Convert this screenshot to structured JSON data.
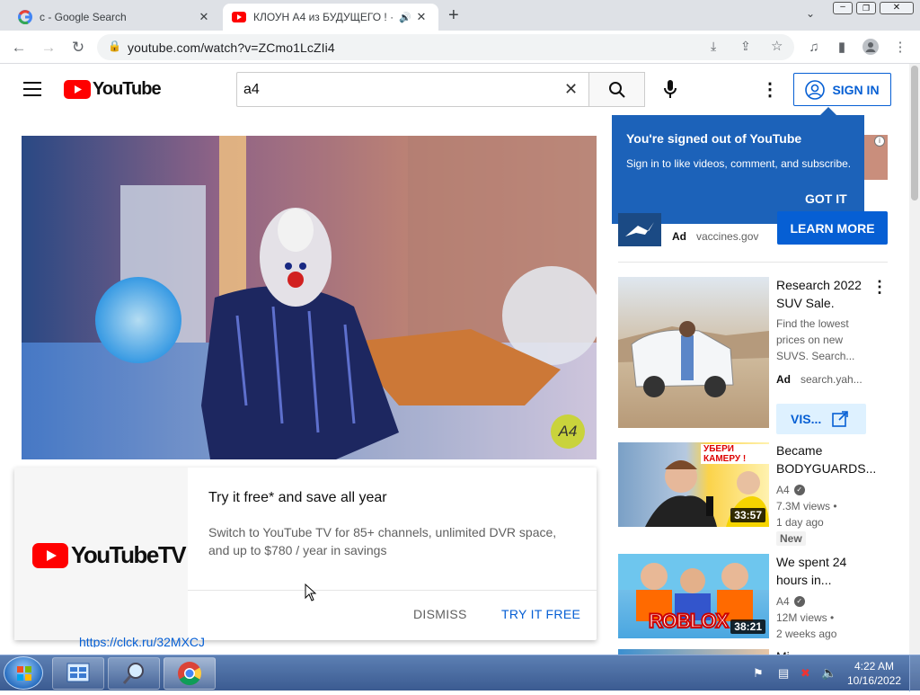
{
  "browser": {
    "tabs": [
      {
        "title": "c - Google Search",
        "favicon": "google-icon"
      },
      {
        "title": "КЛОУН А4 из БУДУЩЕГО ! ·",
        "favicon": "youtube-icon",
        "audio": true
      }
    ],
    "url": "youtube.com/watch?v=ZCmo1LcZIi4"
  },
  "youtube": {
    "logo_text": "YouTube",
    "search_value": "a4",
    "sign_in_label": "SIGN IN",
    "video_watermark": "A4"
  },
  "tooltip": {
    "title": "You're signed out of YouTube",
    "body": "Sign in to like videos, comment, and subscribe.",
    "got_it": "GOT IT"
  },
  "ad_banner": {
    "ad_label": "Ad",
    "source": "vaccines.gov",
    "cta": "LEARN MORE"
  },
  "ytv_promo": {
    "logo_text": "YouTubeTV",
    "headline": "Try it free* and save all year",
    "body": "Switch to YouTube TV for 85+ channels, unlimited DVR space, and up to $780 / year in savings",
    "dismiss": "DISMISS",
    "try_free": "TRY IT FREE",
    "below_link": "https://clck.ru/32MXCJ"
  },
  "sidebar": {
    "ad_video": {
      "title_line1": "Research 2022",
      "title_line2": "SUV Sale.",
      "desc_lines": [
        "Find the lowest",
        "prices on new",
        "SUVS. Search..."
      ],
      "ad_label": "Ad",
      "source": "search.yah...",
      "visit": "VIS..."
    },
    "videos": [
      {
        "title_line1": "Became",
        "title_line2": "BODYGUARDS...",
        "channel": "A4",
        "views": "7.3M views •",
        "age": "1 day ago",
        "badge": "New",
        "duration": "33:57",
        "thumb_text": "УБЕРИ КАМЕРУ !"
      },
      {
        "title_line1": "We spent 24",
        "title_line2": "hours in...",
        "channel": "A4",
        "views": "12M views •",
        "age": "2 weeks ago",
        "duration": "38:21",
        "thumb_text": "ROBLOX"
      }
    ],
    "partial_title": "Mi..."
  },
  "taskbar": {
    "time": "4:22 AM",
    "date": "10/16/2022"
  }
}
